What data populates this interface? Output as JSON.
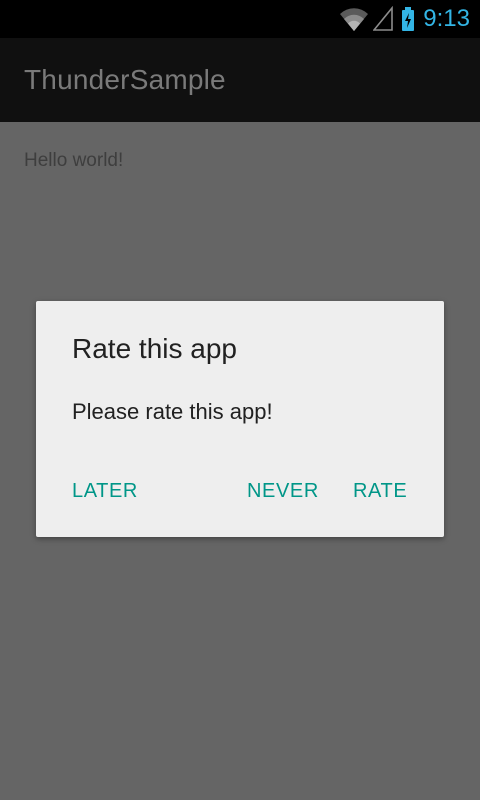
{
  "status_bar": {
    "time": "9:13",
    "icons": [
      "wifi-icon",
      "signal-icon",
      "battery-charging-icon"
    ],
    "accent_color": "#33b5e5"
  },
  "action_bar": {
    "title": "ThunderSample"
  },
  "content": {
    "text": "Hello world!"
  },
  "dialog": {
    "title": "Rate this app",
    "message": "Please rate this app!",
    "buttons": {
      "later": "LATER",
      "never": "NEVER",
      "rate": "RATE"
    },
    "button_color": "#009688"
  },
  "colors": {
    "scrim": "#656565",
    "dialog_background": "#eeeeee",
    "action_bar": "#101010"
  }
}
